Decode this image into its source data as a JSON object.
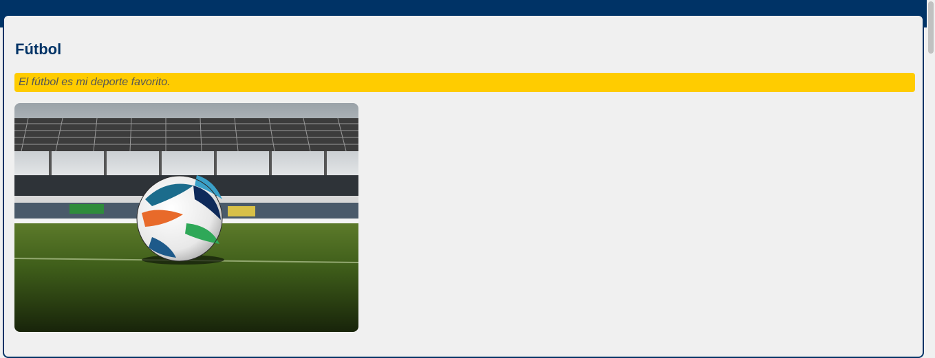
{
  "header": {
    "color": "#003366"
  },
  "section": {
    "title": "Fútbol",
    "quote": "El fútbol es mi deporte favorito.",
    "quote_bg": "#ffcc00"
  },
  "image": {
    "subject": "soccer-ball-on-stadium-pitch"
  }
}
